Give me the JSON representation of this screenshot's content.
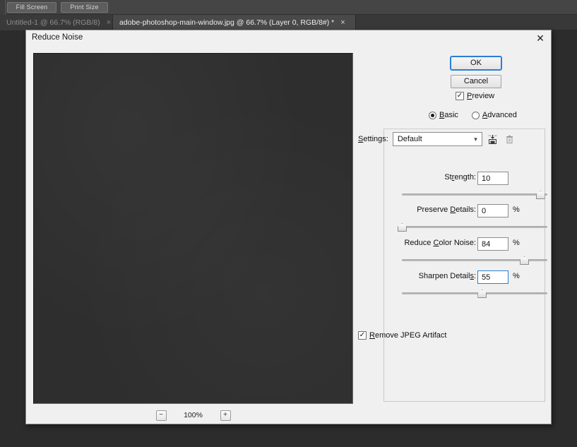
{
  "app": {
    "options_bar": {
      "fill_screen_label": "Fill Screen",
      "print_size_label": "Print Size"
    },
    "tabs": [
      {
        "label": "Untitled-1 @ 66.7% (RGB/8)",
        "close": "×",
        "active": false
      },
      {
        "label": "adobe-photoshop-main-window.jpg @ 66.7% (Layer 0, RGB/8#) *",
        "close": "×",
        "active": true
      }
    ]
  },
  "dialog": {
    "title": "Reduce Noise",
    "close_glyph": "✕",
    "ok_label": "OK",
    "cancel_label": "Cancel",
    "preview": {
      "label": "Preview",
      "checked_glyph": "✓",
      "zoom_out_glyph": "−",
      "zoom_level": "100%",
      "zoom_in_glyph": "+"
    },
    "mode": {
      "basic_label_underlined": "B",
      "basic_label_rest": "asic",
      "advanced_label_underlined": "A",
      "advanced_label_rest": "dvanced",
      "selected": "Basic"
    },
    "settings": {
      "label_underlined": "S",
      "label_rest": "ettings:",
      "value": "Default",
      "options": [
        "Default"
      ],
      "chevron_glyph": "⌵",
      "save_icon_name": "save-settings-icon",
      "delete_icon_name": "delete-settings-icon"
    },
    "sliders": [
      {
        "label_pre": "St",
        "label_underlined": "r",
        "label_post": "ength:",
        "value": "10",
        "unit": "",
        "percent": 95,
        "focused": false
      },
      {
        "label_pre": "Preserve ",
        "label_underlined": "D",
        "label_post": "etails:",
        "value": "0",
        "unit": "%",
        "percent": 0,
        "focused": false
      },
      {
        "label_pre": "Reduce ",
        "label_underlined": "C",
        "label_post": "olor Noise:",
        "value": "84",
        "unit": "%",
        "percent": 84,
        "focused": false
      },
      {
        "label_pre": "Sharpen Detail",
        "label_underlined": "s",
        "label_post": ":",
        "value": "55",
        "unit": "%",
        "percent": 55,
        "focused": true
      }
    ],
    "jpeg_artifact": {
      "label_underlined": "R",
      "label_rest": "emove JPEG Artifact",
      "checked": true,
      "checked_glyph": "✓"
    }
  },
  "colors": {
    "accent_focus": "#2a7fd4",
    "dialog_bg": "#f0f0f0",
    "app_bg": "#2b2b2b",
    "preview_bg": "#2e2e2e"
  }
}
